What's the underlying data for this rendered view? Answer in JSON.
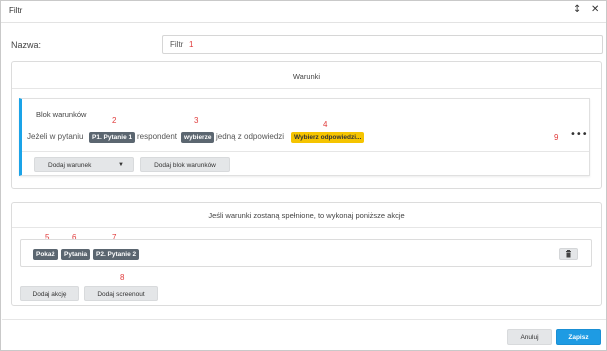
{
  "window": {
    "title": "Filtr",
    "pin_icon": "pin-icon",
    "close_icon": "close-icon"
  },
  "name_field": {
    "label": "Nazwa:",
    "value": "Filtr",
    "marker": "1"
  },
  "conditions": {
    "section_title": "Warunki",
    "block": {
      "title": "Blok warunków",
      "text_if": "Jeżeli w pytaniu",
      "question_chip": "P1. Pytanie 1",
      "text_respondent": "respondent",
      "operator_chip": "wybierze",
      "text_one_of": "jedną z odpowiedzi",
      "answers_chip": "Wybierz odpowiedzi...",
      "markers": {
        "question": "2",
        "operator": "3",
        "answers": "4",
        "menu": "9"
      },
      "add_condition_label": "Dodaj warunek",
      "add_block_label": "Dodaj blok warunków"
    }
  },
  "actions": {
    "section_title": "Jeśli warunki zostaną spełnione, to wykonaj poniższe akcje",
    "row": {
      "action_chip": "Pokaż",
      "target_chip": "Pytania",
      "question_chip": "P2. Pytanie 2",
      "markers": {
        "action": "5",
        "target": "6",
        "question": "7"
      }
    },
    "add_action_label": "Dodaj akcję",
    "add_screenout_label": "Dodaj screenout",
    "screenout_marker": "8"
  },
  "footer": {
    "cancel_label": "Anuluj",
    "save_label": "Zapisz"
  },
  "colors": {
    "accent": "#1e9be3",
    "chip_dark": "#5b6670",
    "chip_yellow": "#f5c400",
    "marker_red": "#e03a3a"
  }
}
